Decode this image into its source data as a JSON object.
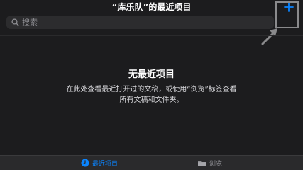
{
  "header": {
    "title": "“库乐队”的最近项目",
    "add_icon": "plus-icon"
  },
  "search": {
    "placeholder": "搜索",
    "value": "",
    "icon": "search-icon"
  },
  "empty_state": {
    "title": "无最近项目",
    "description": "在此处查看最近打开过的文稿，或使用“浏览”标签查看所有文稿和文件夹。"
  },
  "tabbar": {
    "tabs": [
      {
        "label": "最近项目",
        "icon": "clock-icon",
        "selected": true
      },
      {
        "label": "浏览",
        "icon": "folder-icon",
        "selected": false
      }
    ]
  },
  "colors": {
    "background": "#1c1c1e",
    "accent": "#0a84ff",
    "search_bg": "#2c2c2e",
    "tabbar_bg": "#2a2a2c",
    "secondary_text": "#8e8e93",
    "annotation": "#8a8a8c"
  }
}
